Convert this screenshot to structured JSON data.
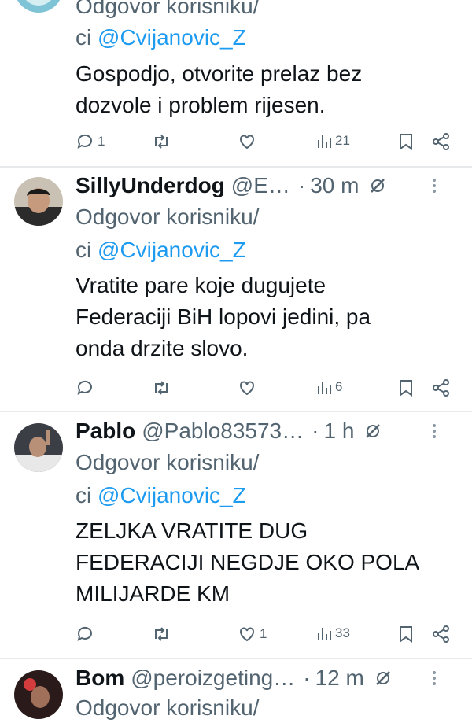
{
  "tweets": [
    {
      "name": "",
      "handle": "",
      "time": "",
      "reply_prefix": "Odgovor korisniku/",
      "reply_ci": "ci",
      "reply_mention": "@Cvijanovic_Z",
      "body_lines": [
        "Gospodjo, otvorite prelaz bez",
        "dozvole i problem rijesen."
      ],
      "replies": "1",
      "retweets": "",
      "likes": "",
      "views": "21"
    },
    {
      "name": "SillyUnderdog",
      "handle": "@E…",
      "time": "30 m",
      "reply_prefix": "Odgovor korisniku/",
      "reply_ci": "ci",
      "reply_mention": "@Cvijanovic_Z",
      "body_lines": [
        "Vratite pare koje dugujete",
        "Federaciji BiH lopovi jedini, pa",
        "onda drzite slovo."
      ],
      "replies": "",
      "retweets": "",
      "likes": "",
      "views": "6"
    },
    {
      "name": "Pablo",
      "handle": "@Pablo83573…",
      "time": "1 h",
      "reply_prefix": "Odgovor korisniku/",
      "reply_ci": "ci",
      "reply_mention": "@Cvijanovic_Z",
      "body_lines": [
        "ZELJKA VRATITE DUG",
        "FEDERACIJI NEGDJE OKO POLA",
        "MILIJARDE KM"
      ],
      "replies": "",
      "retweets": "",
      "likes": "1",
      "views": "33"
    },
    {
      "name": "Bom",
      "handle": "@peroizgeting…",
      "time": "12 m",
      "reply_prefix": "Odgovor korisniku/",
      "reply_ci": "",
      "reply_mention": "",
      "body_lines": [],
      "replies": "",
      "retweets": "",
      "likes": "",
      "views": ""
    }
  ],
  "separator": "·",
  "icons": {
    "reply": "reply-icon",
    "retweet": "retweet-icon",
    "like": "like-icon",
    "views": "views-icon",
    "bookmark": "bookmark-icon",
    "share": "share-icon",
    "grok": "grok-icon",
    "more": "more-icon"
  },
  "colors": {
    "text": "#0f1419",
    "secondary": "#536471",
    "mention": "#1d9bf0",
    "divider": "#e7e9ea"
  }
}
